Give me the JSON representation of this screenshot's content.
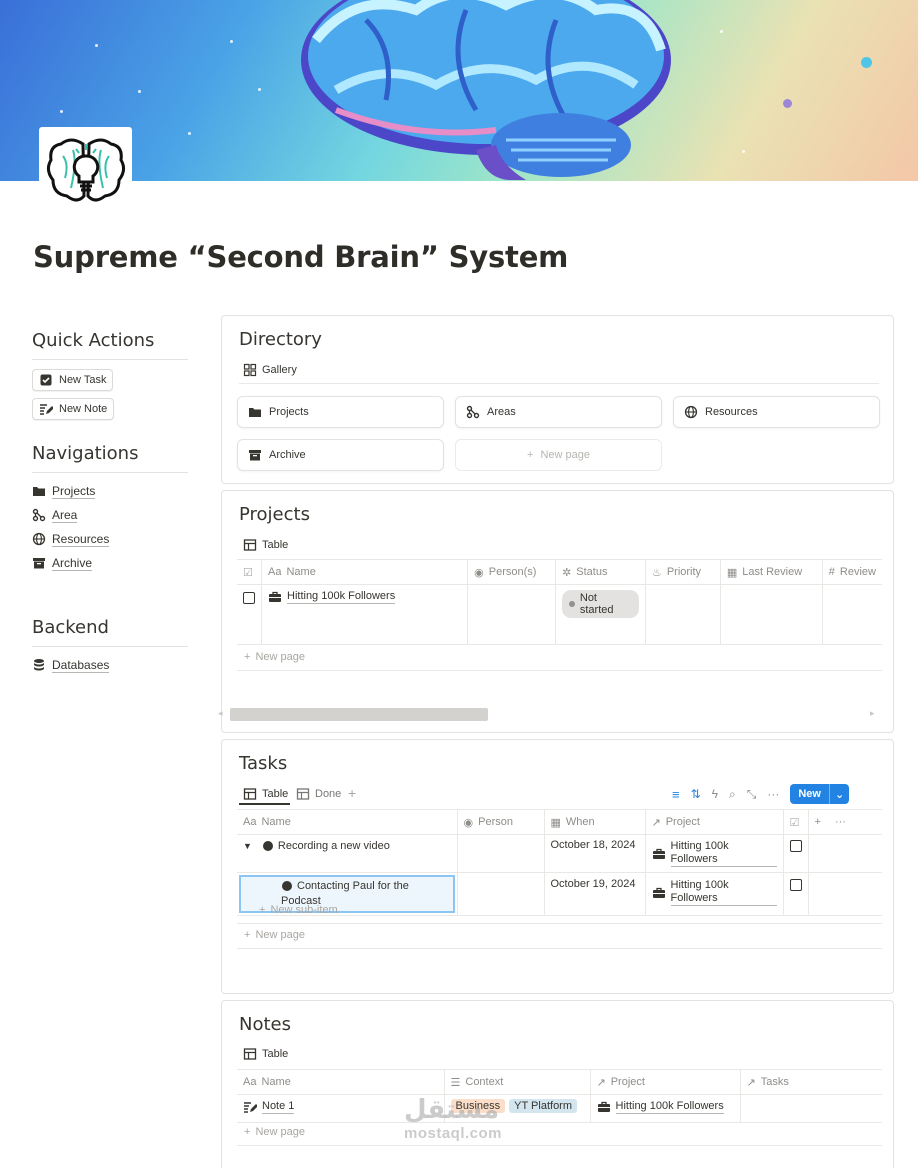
{
  "page": {
    "title": "Supreme “Second Brain” System"
  },
  "quick_actions": {
    "heading": "Quick Actions",
    "new_task": "New Task",
    "new_note": "New Note"
  },
  "navigations": {
    "heading": "Navigations",
    "items": [
      {
        "label": "Projects",
        "icon": "folder-icon"
      },
      {
        "label": "Area",
        "icon": "nodes-icon"
      },
      {
        "label": "Resources",
        "icon": "globe-icon"
      },
      {
        "label": "Archive",
        "icon": "archive-icon"
      }
    ]
  },
  "backend": {
    "heading": "Backend",
    "items": [
      {
        "label": "Databases",
        "icon": "database-icon"
      }
    ]
  },
  "directory": {
    "title": "Directory",
    "view": "Gallery",
    "items": [
      {
        "label": "Projects",
        "icon": "folder-icon"
      },
      {
        "label": "Areas",
        "icon": "nodes-icon"
      },
      {
        "label": "Resources",
        "icon": "globe-icon"
      },
      {
        "label": "Archive",
        "icon": "archive-icon"
      }
    ],
    "new_page": "New page"
  },
  "projects": {
    "title": "Projects",
    "view": "Table",
    "columns": [
      "Name",
      "Person(s)",
      "Status",
      "Priority",
      "Last Review",
      "Review"
    ],
    "column_prefix": {
      "name": "Aa",
      "review": "#"
    },
    "rows": [
      {
        "name": "Hitting 100k Followers",
        "status": "Not started"
      }
    ],
    "new_page": "New page"
  },
  "tasks": {
    "title": "Tasks",
    "views": [
      "Table",
      "Done"
    ],
    "toolbar": {
      "new": "New"
    },
    "columns": [
      "Name",
      "Person",
      "When",
      "Project"
    ],
    "column_prefix": {
      "name": "Aa"
    },
    "rows": [
      {
        "name": "Recording a new video",
        "when": "October 18, 2024",
        "project": "Hitting 100k Followers"
      },
      {
        "name": "Contacting Paul for the Podcast",
        "when": "October 19, 2024",
        "project": "Hitting 100k Followers"
      }
    ],
    "new_sub_item": "New sub-item",
    "new_page": "New page"
  },
  "notes": {
    "title": "Notes",
    "view": "Table",
    "columns": [
      "Name",
      "Context",
      "Project",
      "Tasks"
    ],
    "column_prefix": {
      "name": "Aa"
    },
    "rows": [
      {
        "name": "Note 1",
        "tags": [
          "Business",
          "YT Platform"
        ],
        "project": "Hitting 100k Followers"
      }
    ],
    "new_page": "New page"
  },
  "watermark": {
    "arabic": "مستقل",
    "latin": "mostaql.com"
  },
  "colors": {
    "accent": "#2383e2",
    "tag_business": "#fadec9",
    "tag_yt": "#d3e5ef",
    "status_not_started": "#e3e2e0"
  }
}
